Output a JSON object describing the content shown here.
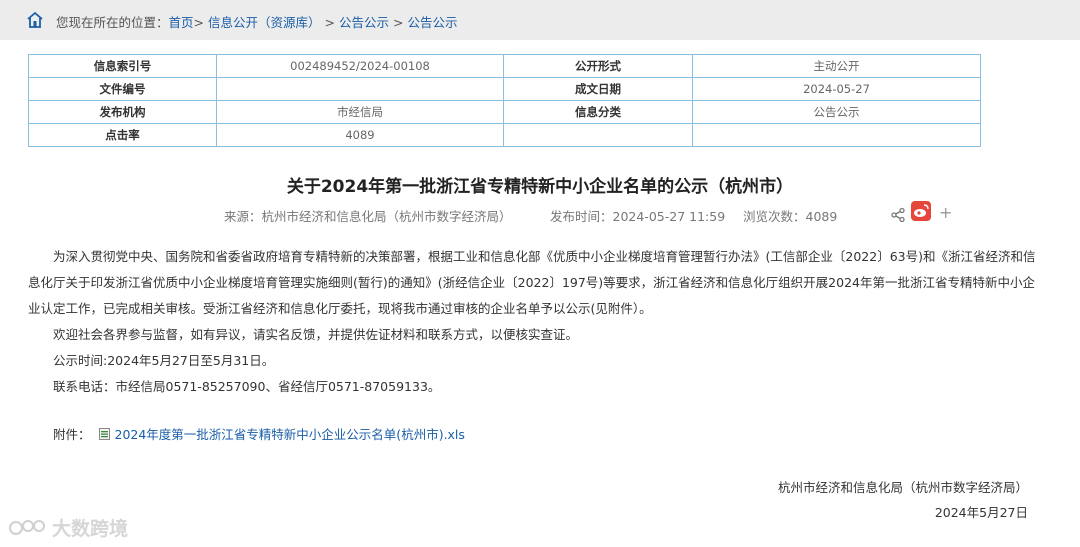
{
  "breadcrumb": {
    "prefix": "您现在所在的位置：",
    "items": [
      "首页",
      "信息公开（资源库）",
      "公告公示",
      "公告公示"
    ],
    "separator": ">"
  },
  "meta_table": {
    "rows": [
      [
        {
          "k": "信息索引号",
          "v": "002489452/2024-00108"
        },
        {
          "k": "公开形式",
          "v": "主动公开"
        }
      ],
      [
        {
          "k": "文件编号",
          "v": ""
        },
        {
          "k": "成文日期",
          "v": "2024-05-27"
        }
      ],
      [
        {
          "k": "发布机构",
          "v": "市经信局"
        },
        {
          "k": "信息分类",
          "v": "公告公示"
        }
      ],
      [
        {
          "k": "点击率",
          "v": "4089"
        },
        {
          "k": "",
          "v": ""
        }
      ]
    ]
  },
  "article": {
    "title": "关于2024年第一批浙江省专精特新中小企业名单的公示（杭州市）",
    "source": "来源：杭州市经济和信息化局（杭州市数字经济局）",
    "publish_time": "发布时间：2024-05-27 11:59",
    "views": "浏览次数：4089",
    "paragraphs": [
      "为深入贯彻党中央、国务院和省委省政府培育专精特新的决策部署，根据工业和信息化部《优质中小企业梯度培育管理暂行办法》(工信部企业〔2022〕63号)和《浙江省经济和信息化厅关于印发浙江省优质中小企业梯度培育管理实施细则(暂行)的通知》(浙经信企业〔2022〕197号)等要求，浙江省经济和信息化厅组织开展2024年第一批浙江省专精特新中小企业认定工作，已完成相关审核。受浙江省经济和信息化厅委托，现将我市通过审核的企业名单予以公示(见附件）。",
      "欢迎社会各界参与监督，如有异议，请实名反馈，并提供佐证材料和联系方式，以便核实查证。",
      "公示时间:2024年5月27日至5月31日。",
      "联系电话：市经信局0571-85257090、省经信厅0571-87059133。"
    ],
    "attachment_label": "附件：",
    "attachment_name": "2024年度第一批浙江省专精特新中小企业公示名单(杭州市).xls",
    "signature_org": "杭州市经济和信息化局（杭州市数字经济局）",
    "signature_date": "2024年5月27日"
  },
  "watermark": "大数跨境",
  "colors": {
    "link": "#1a5ea8",
    "table_border": "#89c0e0",
    "topbar": "#ececec",
    "weibo": "#e6463b"
  }
}
